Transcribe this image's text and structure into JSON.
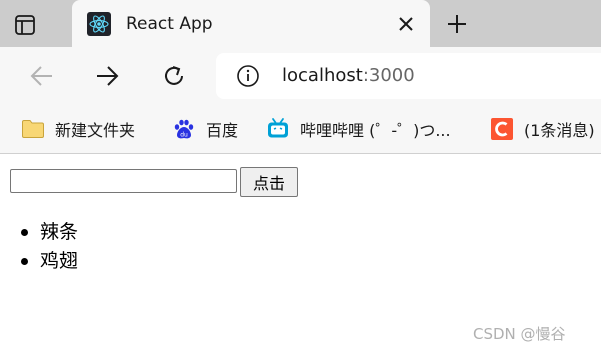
{
  "browser": {
    "tab": {
      "title": "React App"
    },
    "address": {
      "host": "localhost",
      "port": ":3000"
    },
    "bookmarks": [
      {
        "label": "新建文件夹",
        "icon": "folder-icon"
      },
      {
        "label": "百度",
        "icon": "baidu-icon"
      },
      {
        "label": "哔哩哔哩 (゜-゜)つ...",
        "icon": "bilibili-icon"
      },
      {
        "label": "(1条消息)",
        "icon": "csdn-icon"
      }
    ]
  },
  "page": {
    "input_value": "",
    "button_label": "点击",
    "items": [
      "辣条",
      "鸡翅"
    ]
  },
  "watermark": "CSDN @慢谷",
  "colors": {
    "tabstrip": "#cccccc",
    "toolbar": "#f7f7f7",
    "react_blue": "#61dafb",
    "bilibili": "#00a1d6",
    "csdn": "#fc5531",
    "baidu": "#2932e1",
    "folder": "#f8d775"
  }
}
